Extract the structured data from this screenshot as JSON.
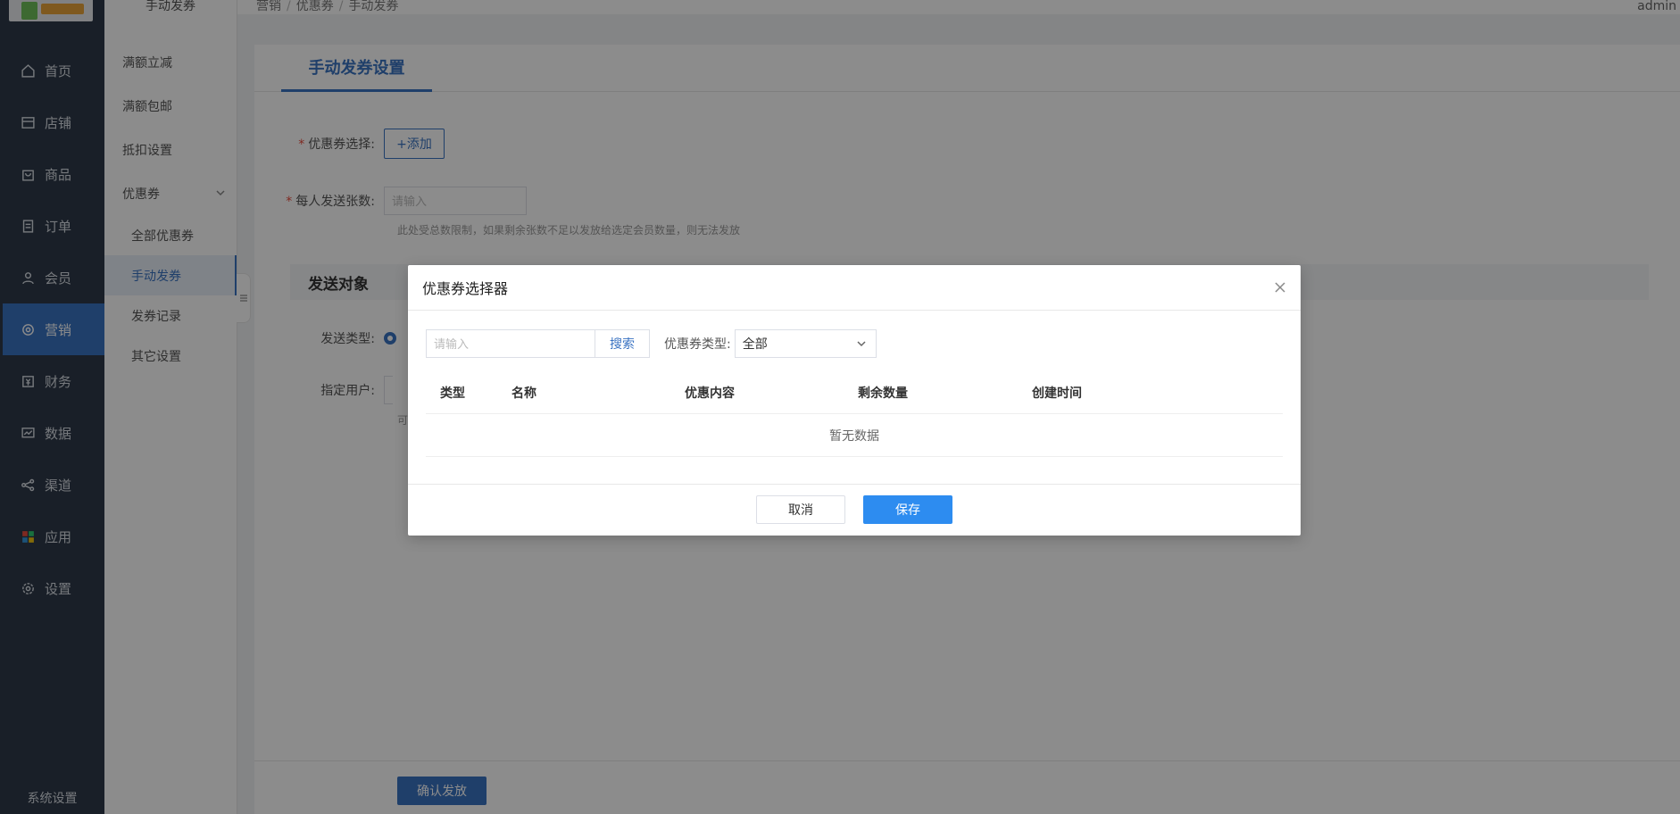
{
  "nav": {
    "items": [
      {
        "label": "首页",
        "icon": "home-icon"
      },
      {
        "label": "店铺",
        "icon": "store-icon"
      },
      {
        "label": "商品",
        "icon": "bag-icon"
      },
      {
        "label": "订单",
        "icon": "order-icon"
      },
      {
        "label": "会员",
        "icon": "user-icon"
      },
      {
        "label": "营销",
        "icon": "marketing-icon"
      },
      {
        "label": "财务",
        "icon": "finance-icon"
      },
      {
        "label": "数据",
        "icon": "chart-icon"
      },
      {
        "label": "渠道",
        "icon": "share-icon"
      },
      {
        "label": "应用",
        "icon": "apps-icon"
      },
      {
        "label": "设置",
        "icon": "gear-icon"
      }
    ],
    "active_index": 5,
    "system_settings": "系统设置"
  },
  "subnav": {
    "title": "手动发券",
    "items": [
      "满额立减",
      "满额包邮",
      "抵扣设置"
    ],
    "group_label": "优惠券",
    "group_children": [
      "全部优惠券",
      "手动发券",
      "发券记录",
      "其它设置"
    ],
    "active_child_index": 1
  },
  "breadcrumb": [
    "营销",
    "优惠券",
    "手动发券"
  ],
  "user": {
    "name": "admin"
  },
  "page": {
    "tab": "手动发券设置",
    "coupon_select_label": "优惠券选择:",
    "add_button": "+添加",
    "per_person_label": "每人发送张数:",
    "per_person_placeholder": "请输入",
    "per_person_hint": "此处受总数限制，如果剩余张数不足以发放给选定会员数量，则无法发放",
    "section_title": "发送对象",
    "send_type_label": "发送类型:",
    "specified_user_label": "指定用户:",
    "specified_user_hint_fragment": "可",
    "confirm_button": "确认发放"
  },
  "modal": {
    "title": "优惠券选择器",
    "search_placeholder": "请输入",
    "search_button": "搜索",
    "type_label": "优惠券类型:",
    "type_value": "全部",
    "columns": [
      "类型",
      "名称",
      "优惠内容",
      "剩余数量",
      "创建时间"
    ],
    "empty_text": "暂无数据",
    "cancel_button": "取消",
    "save_button": "保存"
  }
}
